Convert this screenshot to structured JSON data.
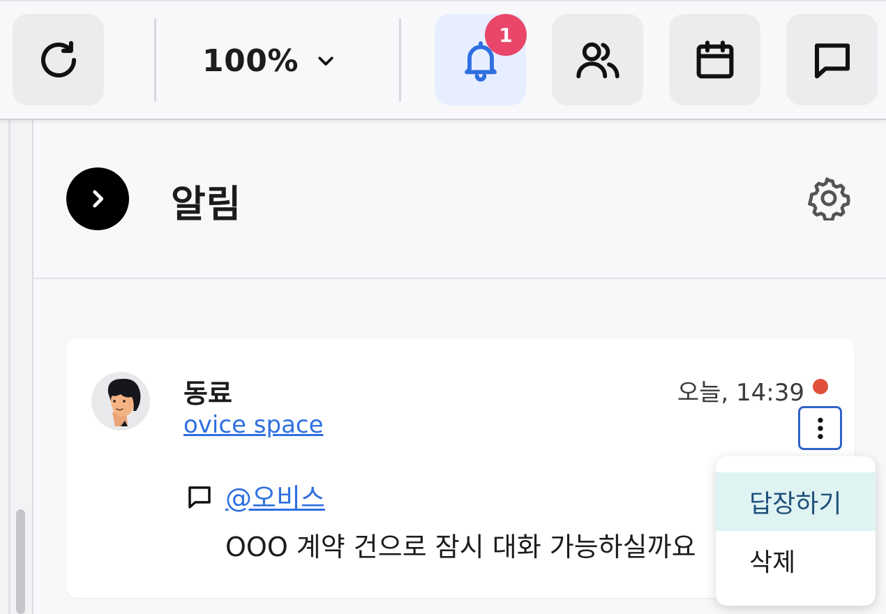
{
  "toolbar": {
    "zoom_value": "100%",
    "notification_count": "1",
    "icons": [
      "refresh-icon",
      "chevron-down-icon",
      "bell-icon",
      "people-icon",
      "calendar-icon",
      "chat-icon"
    ],
    "active_color": "#2f6fe0",
    "badge_color": "#e9466a"
  },
  "panel": {
    "title": "알림",
    "icons": [
      "chevron-right-icon",
      "gear-icon"
    ]
  },
  "notification": {
    "sender": "동료",
    "space": "ovice space",
    "timestamp": "오늘, 14:39",
    "unread": true,
    "mention": "@오비스",
    "message": "OOO 계약 건으로 잠시 대화 가능하실까요"
  },
  "menu": {
    "reply_label": "답장하기",
    "delete_label": "삭제"
  }
}
